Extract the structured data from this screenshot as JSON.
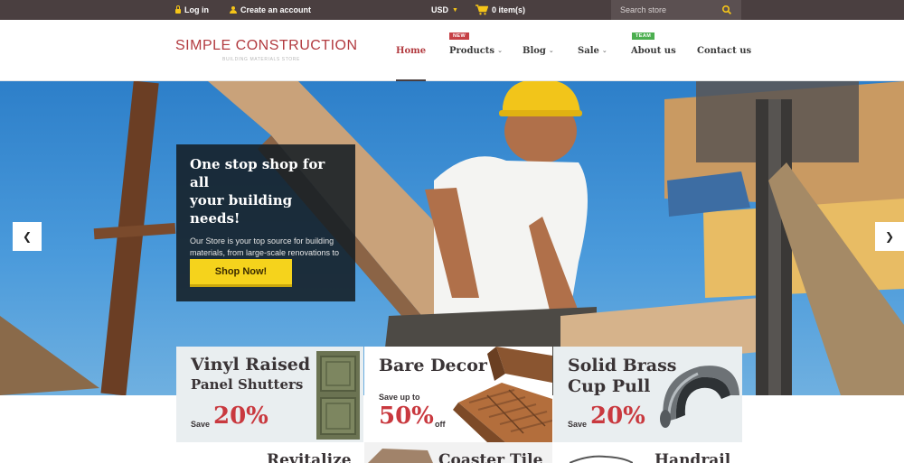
{
  "topbar": {
    "login": "Log in",
    "create_account": "Create an account",
    "currency": "USD",
    "cart": "0 item(s)",
    "search_placeholder": "Search store"
  },
  "header": {
    "logo_name": "SIMPLE CONSTRUCTION",
    "logo_tagline": "BUILDING MATERIALS STORE",
    "nav": [
      {
        "label": "Home",
        "active": true
      },
      {
        "label": "Products",
        "badge": "NEW"
      },
      {
        "label": "Blog"
      },
      {
        "label": "Sale"
      },
      {
        "label": "About us",
        "badge": "TEAM"
      },
      {
        "label": "Contact us"
      }
    ]
  },
  "hero": {
    "heading_line1": "One stop shop for all",
    "heading_line2": "your building needs!",
    "text": "Our Store is your top source for building materials, from large-scale renovations to small do-it-yourself projects.",
    "button": "Shop Now!",
    "prev_icon": "chevron-left-icon",
    "next_icon": "chevron-right-icon"
  },
  "promos": [
    {
      "title_line1": "Vinyl Raised",
      "title_line2": "Panel Shutters",
      "save_label": "Save",
      "percent": "20%"
    },
    {
      "title_line1": "Bare Decor",
      "save_label": "Save up to",
      "percent": "50%",
      "suffix": "off"
    },
    {
      "title_line1": "Solid Brass",
      "title_line2": "Cup Pull",
      "save_label": "Save",
      "percent": "20%"
    }
  ],
  "promos_row2": [
    {
      "title": "Revitalize"
    },
    {
      "title": "Coaster Tile"
    },
    {
      "title": "Handrail"
    }
  ],
  "colors": {
    "brand_red": "#b23a3f",
    "topbar_bg": "#4a3f40",
    "accent_yellow": "#f5d31c",
    "badge_green": "#4caf50"
  }
}
